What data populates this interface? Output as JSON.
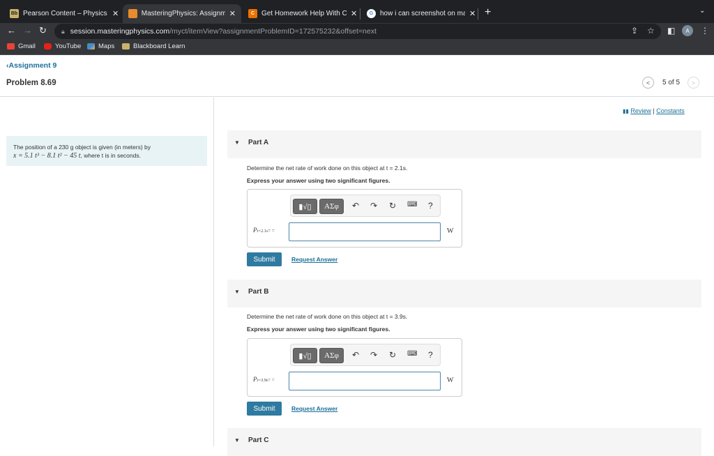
{
  "browser": {
    "tabs": [
      {
        "title": "Pearson Content – Physics and",
        "icon": "blackboard-icon",
        "active": false
      },
      {
        "title": "MasteringPhysics: Assignment",
        "icon": "masteringphysics-icon",
        "active": true
      },
      {
        "title": "Get Homework Help With Cheg",
        "icon": "chegg-icon",
        "active": false
      },
      {
        "title": "how i can screenshot on macb",
        "icon": "google-icon",
        "active": false
      }
    ],
    "url_host": "session.masteringphysics.com",
    "url_path": "/myct/itemView?assignmentProblemID=172575232&offset=next",
    "avatar_letter": "A",
    "bookmarks": [
      {
        "label": "Gmail",
        "icon": "gmail-icon"
      },
      {
        "label": "YouTube",
        "icon": "youtube-icon"
      },
      {
        "label": "Maps",
        "icon": "maps-icon"
      },
      {
        "label": "Blackboard Learn",
        "icon": "blackboard-icon"
      }
    ]
  },
  "header": {
    "back_link": "Assignment 9",
    "problem_title": "Problem 8.69",
    "pager": "5 of 5"
  },
  "problem": {
    "text_line1": "The position of a 230 g object is given (in meters) by",
    "equation": "x = 5.1 t³ − 8.1 t² − 45 t",
    "text_line2_suffix": ", where t is in seconds."
  },
  "links": {
    "review": "Review",
    "separator": "|",
    "constants": "Constants"
  },
  "parts": [
    {
      "label": "Part A",
      "question": "Determine the net rate of work done on this object at t = 2.1s.",
      "instruction": "Express your answer using two significant figures.",
      "answer_label": "P",
      "answer_subscript": "t=2.1s",
      "answer_suffix": "= =",
      "answer_value": "",
      "unit": "W",
      "submit": "Submit",
      "request": "Request Answer"
    },
    {
      "label": "Part B",
      "question": "Determine the net rate of work done on this object at t = 3.9s.",
      "instruction": "Express your answer using two significant figures.",
      "answer_label": "P",
      "answer_subscript": "t=3.9s",
      "answer_suffix": "= =",
      "answer_value": "",
      "unit": "W",
      "submit": "Submit",
      "request": "Request Answer"
    },
    {
      "label": "Part C"
    }
  ],
  "toolbar": {
    "symbols": "ΑΣφ",
    "help": "?"
  }
}
